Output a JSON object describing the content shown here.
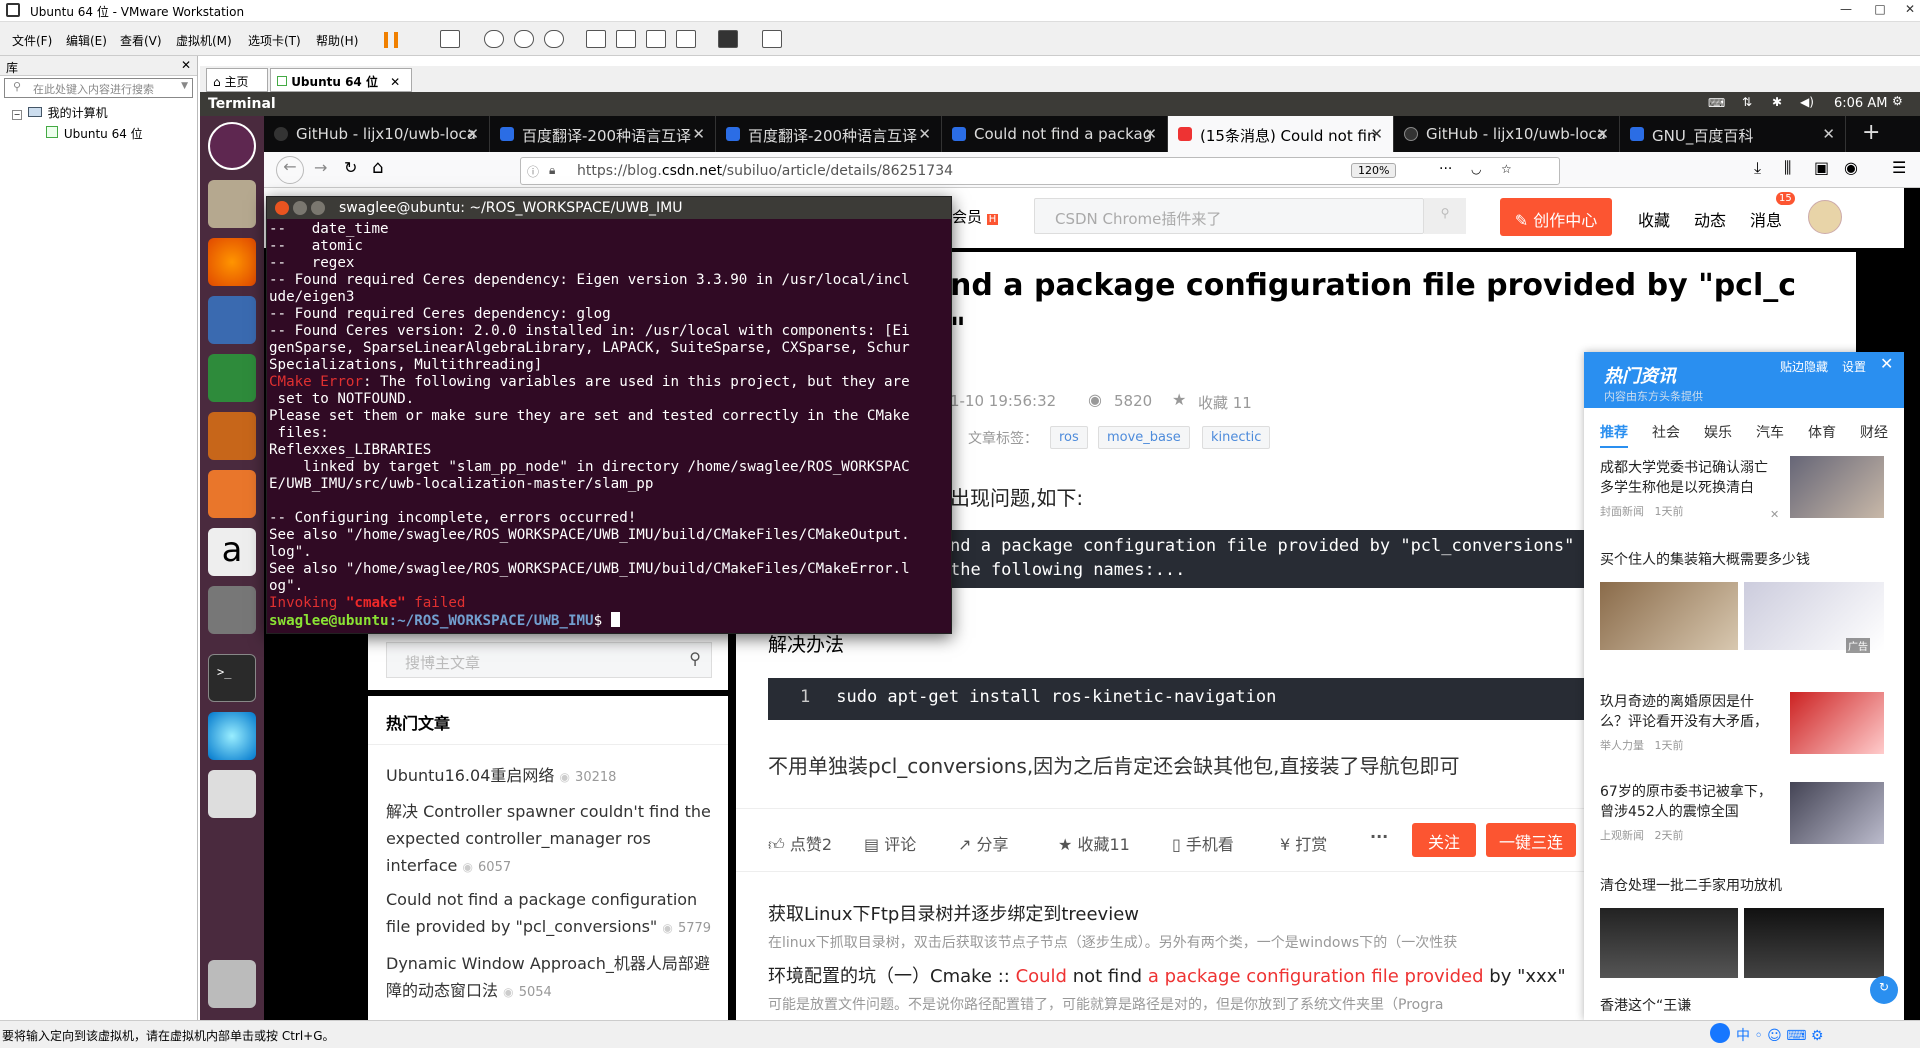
{
  "vmware": {
    "title": "Ubuntu 64 位 - VMware Workstation",
    "menu": [
      "文件(F)",
      "编辑(E)",
      "查看(V)",
      "虚拟机(M)",
      "选项卡(T)",
      "帮助(H)"
    ],
    "library_title": "库",
    "search_placeholder": "在此处键入内容进行搜索",
    "tree_root": "我的计算机",
    "tree_child": "Ubuntu 64 位",
    "tab_home": "主页",
    "tab_vm": "Ubuntu 64 位",
    "status_text": "要将输入定向到该虚拟机，请在虚拟机内部单击或按 Ctrl+G。"
  },
  "ubuntu": {
    "app_name": "Terminal",
    "clock": "6:06 AM"
  },
  "firefox": {
    "tabs": [
      {
        "label": "GitHub - lijx10/uwb-loca",
        "color": "#333"
      },
      {
        "label": "百度翻译-200种语言互译",
        "color": "#2b6de5"
      },
      {
        "label": "百度翻译-200种语言互译",
        "color": "#2b6de5"
      },
      {
        "label": "Could not find a packag",
        "color": "#2b6de5"
      },
      {
        "label": "(15条消息) Could not fin",
        "color": "#e33"
      },
      {
        "label": "GitHub - lijx10/uwb-loca",
        "color": "#333"
      },
      {
        "label": "GNU_百度百科",
        "color": "#2b6de5"
      }
    ],
    "url_prefix": "https://blog.",
    "url_host": "csdn.net",
    "url_path": "/subiluo/article/details/86251734",
    "zoom": "120%"
  },
  "csdn": {
    "vip": "会员",
    "search_placeholder": "CSDN Chrome插件来了",
    "create_btn": "创作中心",
    "nav": [
      "收藏",
      "动态",
      "消息"
    ],
    "msg_badge": "15",
    "title_line1": "nd a package configuration file provided by \"pcl_c",
    "title_line2": "\"",
    "date": "1-10 19:56:32",
    "views": "5820",
    "fav": "收藏 11",
    "tags_label": "文章标签：",
    "tags": [
      "ros",
      "move_base",
      "kinectic"
    ],
    "intro": "出现问题,如下:",
    "code1_l1": "nd a package configuration file provided by \"pcl_conversions\"",
    "code1_l2": "the following names:...",
    "solution": "解决办法",
    "code2_num": "1",
    "code2": "sudo apt-get install ros-kinetic-navigation",
    "para": "不用单独装pcl_conversions,因为之后肯定还会缺其他包,直接装了导航包即可",
    "actions": [
      "点赞2",
      "评论",
      "分享",
      "收藏11",
      "手机看",
      "打赏",
      "···"
    ],
    "follow": "关注",
    "triple": "一键三连",
    "rec1_title": "获取Linux下Ftp目录树并逐步绑定到treeview",
    "rec1_desc": "在linux下抓取目录树，双击后获取该节点子节点（逐步生成）。另外有两个类，一个是windows下的（一次性获",
    "rec2_a": "环境配置的坑（一）",
    "rec2_b": "Cmake :: ",
    "rec2_c": "Could",
    "rec2_d": " not find ",
    "rec2_e": "a package configuration file provided",
    "rec2_f": " by \"xxx\"",
    "rec2_desc": "可能是放置文件问题。不是说你路径配置错了，可能就算是路径是对的，但是你放到了系统文件夹里（Progra",
    "sidebar_search": "搜博主文章",
    "hot_title": "热门文章",
    "hot": [
      {
        "title": "Ubuntu16.04重启网络",
        "count": "30218"
      },
      {
        "title": "解决 Controller spawner couldn't find the expected controller_manager ros interface",
        "count": "6057"
      },
      {
        "title": "Could not find a package configuration file provided by \"pcl_conversions\"",
        "count": "5779"
      },
      {
        "title": "Dynamic Window Approach_机器人局部避障的动态窗口法",
        "count": "5054"
      }
    ]
  },
  "terminal": {
    "title": "swaglee@ubuntu: ~/ROS_WORKSPACE/UWB_IMU",
    "lines": [
      "--   date_time",
      "--   atomic",
      "--   regex",
      "-- Found required Ceres dependency: Eigen version 3.3.90 in /usr/local/incl",
      "ude/eigen3",
      "-- Found required Ceres dependency: glog",
      "-- Found Ceres version: 2.0.0 installed in: /usr/local with components: [Ei",
      "genSparse, SparseLinearAlgebraLibrary, LAPACK, SuiteSparse, CXSparse, Schur",
      "Specializations, Multithreading]"
    ],
    "err_label": "CMake Error",
    "err_rest": ": The following variables are used in this project, but they are",
    "lines2": [
      " set to NOTFOUND.",
      "Please set them or make sure they are set and tested correctly in the CMake",
      " files:",
      "Reflexxes_LIBRARIES",
      "    linked by target \"slam_pp_node\" in directory /home/swaglee/ROS_WORKSPAC",
      "E/UWB_IMU/src/uwb-localization-master/slam_pp",
      "",
      "-- Configuring incomplete, errors occurred!",
      "See also \"/home/swaglee/ROS_WORKSPACE/UWB_IMU/build/CMakeFiles/CMakeOutput.",
      "log\".",
      "See also \"/home/swaglee/ROS_WORKSPACE/UWB_IMU/build/CMakeFiles/CMakeError.l",
      "og\"."
    ],
    "invoke_a": "Invoking ",
    "invoke_b": "\"cmake\"",
    "invoke_c": " failed",
    "prompt_user": "swaglee@ubuntu",
    "prompt_path": ":~/ROS_WORKSPACE/UWB_IMU",
    "prompt_end": "$ "
  },
  "news": {
    "title": "热门资讯",
    "subtitle": "内容由东方头条提供",
    "hide": "贴边隐藏",
    "settings": "设置",
    "tabs": [
      "推荐",
      "社会",
      "娱乐",
      "汽车",
      "体育",
      "财经"
    ],
    "items": [
      {
        "title": "成都大学党委书记确认溺亡 多学生称他是以死换清白",
        "src": "封面新闻",
        "time": "1天前"
      },
      {
        "title": "买个住人的集装箱大概需要多少钱",
        "src": "",
        "time": ""
      },
      {
        "title": "玖月奇迹的离婚原因是什么？评论看开没有大矛盾，",
        "src": "举人力量",
        "time": "1天前"
      },
      {
        "title": "67岁的原市委书记被拿下，曾涉452人的震惊全国",
        "src": "上观新闻",
        "time": "2天前"
      },
      {
        "title": "清仓处理一批二手家用功放机",
        "src": "",
        "time": ""
      },
      {
        "title": "香港这个“王谦",
        "src": "",
        "time": ""
      }
    ],
    "ad": "广告"
  },
  "colors": {
    "csdn_red": "#fc5531",
    "terminal_bg": "#300a24",
    "news_blue": "#2a8ff0"
  }
}
